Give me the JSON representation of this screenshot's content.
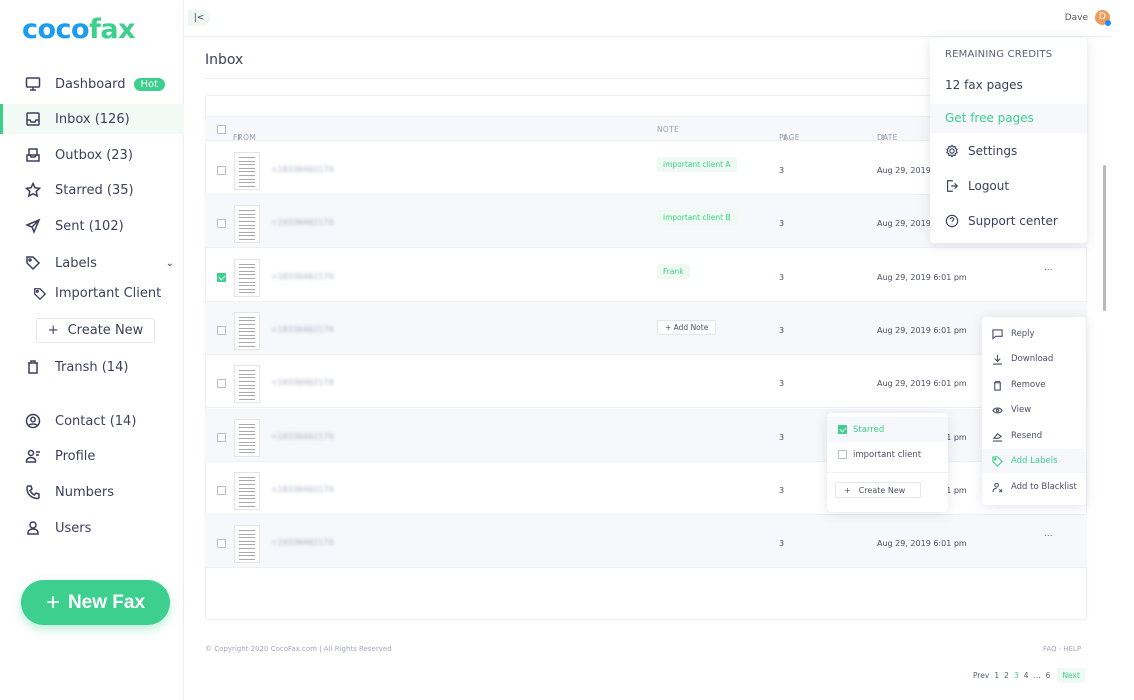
{
  "brand": {
    "part1": "coco",
    "part2": "fax",
    "color_primary": "#1a9df0",
    "color_accent": "#3ccf8e"
  },
  "sidebar": {
    "items": [
      {
        "label": "Dashboard",
        "icon": "monitor-icon",
        "badge": "Hot"
      },
      {
        "label": "Inbox  (126)",
        "icon": "inbox-icon",
        "active": true
      },
      {
        "label": "Outbox  (23)",
        "icon": "outbox-icon"
      },
      {
        "label": "Starred  (35)",
        "icon": "star-icon"
      },
      {
        "label": "Sent  (102)",
        "icon": "send-icon"
      },
      {
        "label": "Labels",
        "icon": "tag-icon",
        "expanded": true
      },
      {
        "label": "Transh  (14)",
        "icon": "trash-icon"
      },
      {
        "label": "Contact   (14)",
        "icon": "contact-icon"
      },
      {
        "label": "Profile",
        "icon": "profile-icon"
      },
      {
        "label": "Numbers",
        "icon": "phone-icon"
      },
      {
        "label": "Users",
        "icon": "user-icon"
      }
    ],
    "label_items": [
      {
        "label": "Important Client"
      }
    ],
    "create_new": "Create New",
    "new_fax": "New Fax"
  },
  "topbar": {
    "collapse": "|<",
    "user_name": "Dave",
    "avatar_initial": "D"
  },
  "page": {
    "title": "Inbox"
  },
  "table": {
    "columns": {
      "from": "FROM",
      "note": "NOTE",
      "page": "PAGE",
      "date": "DATE"
    },
    "rows": [
      {
        "from": "+18336462174",
        "note": "important client A",
        "page": "3",
        "date": "Aug 29, 2019",
        "checked": false
      },
      {
        "from": "+18336462174",
        "note": "important client B",
        "page": "3",
        "date": "Aug 29, 2019",
        "checked": false
      },
      {
        "from": "+18336462174",
        "note": "Frank",
        "page": "3",
        "date": "Aug 29, 2019 6:01 pm",
        "checked": true,
        "more": "..."
      },
      {
        "from": "+18336462174",
        "note_button": "Add Note",
        "page": "3",
        "date": "Aug 29, 2019 6:01 pm",
        "checked": false
      },
      {
        "from": "+18336462174",
        "page": "3",
        "date": "Aug 29, 2019 6:01 pm",
        "checked": false
      },
      {
        "from": "+18336462174",
        "page": "3",
        "date": "Aug 29, 2019 6:01 pm",
        "checked": false
      },
      {
        "from": "+18336462174",
        "page": "3",
        "date": "Aug 29, 2019 6:01 pm",
        "checked": false
      },
      {
        "from": "+18336462174",
        "page": "3",
        "date": "Aug 29, 2019 6:01 pm",
        "checked": false,
        "more": "..."
      }
    ]
  },
  "account_menu": {
    "header": "REMAINING CREDITS",
    "credits": "12 fax pages",
    "free": "Get free pages",
    "items": [
      {
        "label": "Settings",
        "icon": "gear-icon"
      },
      {
        "label": "Logout",
        "icon": "logout-icon"
      },
      {
        "label": "Support center",
        "icon": "help-icon"
      }
    ]
  },
  "action_menu": {
    "items": [
      {
        "label": "Reply",
        "icon": "reply-icon"
      },
      {
        "label": "Download",
        "icon": "download-icon"
      },
      {
        "label": "Remove",
        "icon": "trash-icon"
      },
      {
        "label": "View",
        "icon": "eye-icon"
      },
      {
        "label": "Resend",
        "icon": "resend-icon"
      },
      {
        "label": "Add Labels",
        "icon": "tag-icon",
        "highlighted": true
      },
      {
        "label": "Add to Blacklist",
        "icon": "block-user-icon"
      }
    ]
  },
  "label_menu": {
    "options": [
      {
        "label": "Starred",
        "checked": true
      },
      {
        "label": "important client",
        "checked": false
      }
    ],
    "create_new": "Create New"
  },
  "footer": {
    "copyright": "© Copyright 2020 CocoFax.com | All Rights Reserved",
    "help": "FAQ · HELP"
  },
  "pagination": {
    "prev": "Prev",
    "pages": [
      "1",
      "2",
      "3",
      "4",
      "...",
      "6"
    ],
    "current": "3",
    "next": "Next"
  }
}
